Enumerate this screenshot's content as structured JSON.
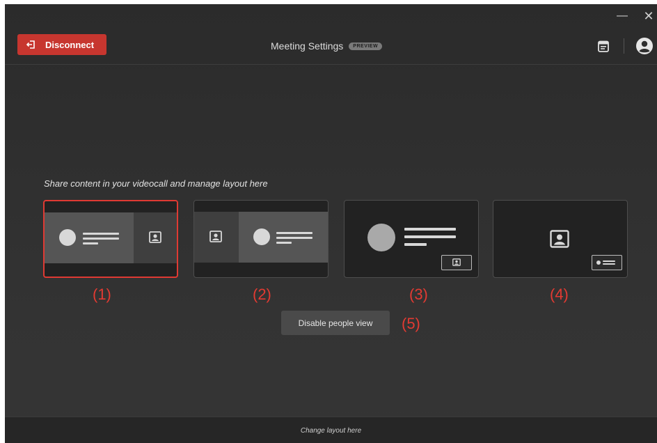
{
  "window": {
    "minimize_glyph": "—",
    "close_glyph": "✕"
  },
  "header": {
    "disconnect_label": "Disconnect",
    "title": "Meeting Settings",
    "badge": "PREVIEW",
    "icons": [
      "logout-icon",
      "calendar-icon",
      "account-icon"
    ]
  },
  "main": {
    "instruction": "Share content in your videocall and manage layout here",
    "layouts": [
      {
        "label": "(1)",
        "selected": true
      },
      {
        "label": "(2)",
        "selected": false
      },
      {
        "label": "(3)",
        "selected": false
      },
      {
        "label": "(4)",
        "selected": false
      }
    ],
    "people_view_button": "Disable people view",
    "people_view_label": "(5)"
  },
  "footer": {
    "text": "Change layout here"
  },
  "colors": {
    "accent": "#c7362f",
    "annotation": "#e23a32",
    "background": "#2e2e2e"
  }
}
